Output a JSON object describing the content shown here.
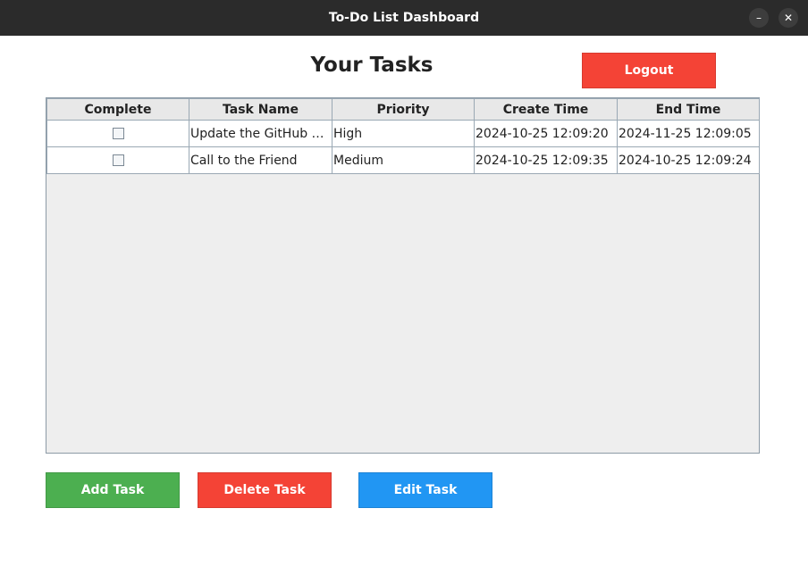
{
  "window": {
    "title": "To-Do List Dashboard",
    "minimize_glyph": "–",
    "close_glyph": "✕"
  },
  "heading": "Your Tasks",
  "logout_label": "Logout",
  "table": {
    "columns": [
      "Complete",
      "Task Name",
      "Priority",
      "Create Time",
      "End Time"
    ],
    "rows": [
      {
        "complete": false,
        "name": "Update the GitHub Pr...",
        "priority": "High",
        "create": "2024-10-25 12:09:20",
        "end": "2024-11-25 12:09:05"
      },
      {
        "complete": false,
        "name": "Call to the Friend",
        "priority": "Medium",
        "create": "2024-10-25 12:09:35",
        "end": "2024-10-25 12:09:24"
      }
    ]
  },
  "buttons": {
    "add": "Add Task",
    "delete": "Delete Task",
    "edit": "Edit Task"
  },
  "colors": {
    "red": "#f44336",
    "green": "#4caf50",
    "blue": "#2196f3",
    "titlebar": "#2b2b2b"
  }
}
